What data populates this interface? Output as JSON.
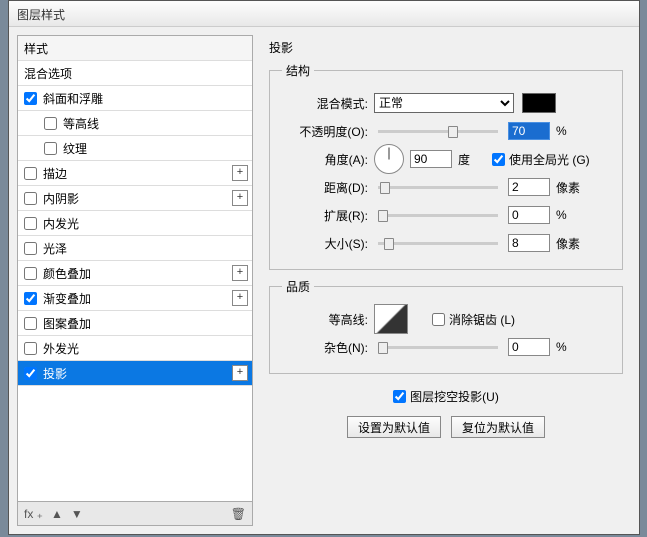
{
  "dialog": {
    "title": "图层样式"
  },
  "styles": {
    "header": "样式",
    "blending": "混合选项",
    "items": [
      {
        "id": "bevel",
        "label": "斜面和浮雕",
        "checked": true,
        "plus": false,
        "indent": false
      },
      {
        "id": "contour",
        "label": "等高线",
        "checked": false,
        "plus": false,
        "indent": true
      },
      {
        "id": "texture",
        "label": "纹理",
        "checked": false,
        "plus": false,
        "indent": true
      },
      {
        "id": "stroke",
        "label": "描边",
        "checked": false,
        "plus": true,
        "indent": false
      },
      {
        "id": "inner-shadow",
        "label": "内阴影",
        "checked": false,
        "plus": true,
        "indent": false
      },
      {
        "id": "inner-glow",
        "label": "内发光",
        "checked": false,
        "plus": false,
        "indent": false
      },
      {
        "id": "satin",
        "label": "光泽",
        "checked": false,
        "plus": false,
        "indent": false
      },
      {
        "id": "color-overlay",
        "label": "颜色叠加",
        "checked": false,
        "plus": true,
        "indent": false
      },
      {
        "id": "gradient-overlay",
        "label": "渐变叠加",
        "checked": true,
        "plus": true,
        "indent": false
      },
      {
        "id": "pattern-overlay",
        "label": "图案叠加",
        "checked": false,
        "plus": false,
        "indent": false
      },
      {
        "id": "outer-glow",
        "label": "外发光",
        "checked": false,
        "plus": false,
        "indent": false
      },
      {
        "id": "drop-shadow",
        "label": "投影",
        "checked": true,
        "plus": true,
        "indent": false,
        "selected": true
      }
    ],
    "footer": {
      "fx": "fx ₊",
      "up": "▲",
      "down": "▼",
      "trash": "🗑"
    }
  },
  "drop_shadow": {
    "title": "投影",
    "structure": {
      "legend": "结构",
      "blend_mode": {
        "label": "混合模式:",
        "value": "正常"
      },
      "opacity": {
        "label": "不透明度(O):",
        "value": "70",
        "unit": "%",
        "thumb": 58
      },
      "angle": {
        "label": "角度(A):",
        "value": "90",
        "unit": "度",
        "global": {
          "checked": true,
          "label": "使用全局光 (G)"
        }
      },
      "distance": {
        "label": "距离(D):",
        "value": "2",
        "unit": "像素",
        "thumb": 2
      },
      "spread": {
        "label": "扩展(R):",
        "value": "0",
        "unit": "%",
        "thumb": 0
      },
      "size": {
        "label": "大小(S):",
        "value": "8",
        "unit": "像素",
        "thumb": 5
      }
    },
    "quality": {
      "legend": "品质",
      "contour": {
        "label": "等高线:",
        "anti_alias": {
          "checked": false,
          "label": "消除锯齿 (L)"
        }
      },
      "noise": {
        "label": "杂色(N):",
        "value": "0",
        "unit": "%",
        "thumb": 0
      }
    },
    "knockout": {
      "checked": true,
      "label": "图层挖空投影(U)"
    },
    "buttons": {
      "default": "设置为默认值",
      "reset": "复位为默认值"
    }
  }
}
